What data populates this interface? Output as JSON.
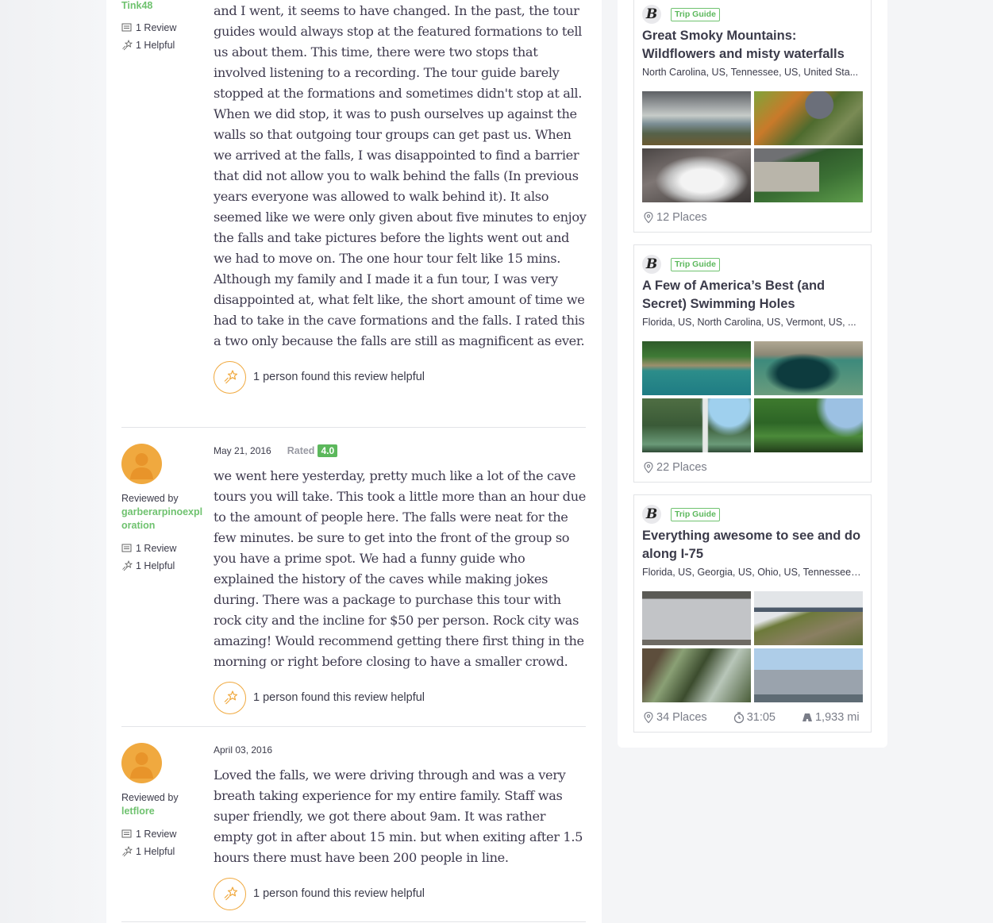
{
  "reviews": [
    {
      "reviewer_name": "Tink48",
      "review_count": "1 Review",
      "helpful_count": "1 Helpful",
      "text": "and I went, it seems to have changed. In the past, the tour guides would always stop at the featured formations to tell us about them. This time, there were two stops that involved listening to a recording. The tour guide barely stopped at the formations and sometimes didn't stop at all. When we did stop, it was to push ourselves up against the walls so that outgoing tour groups can get past us. When we arrived at the falls, I was disappointed to find a barrier that did not allow you to walk behind the falls (In previous years everyone was allowed to walk behind it). It also seemed like we were only given about five minutes to enjoy the falls and take pictures before the lights went out and we had to move on. The one hour tour felt like 15 mins. Although my family and I made it a fun tour, I was very disappointed at, what felt like, the short amount of time we had to take in the cave formations and the falls. I rated this a two only because the falls are still as magnificent as ever.",
      "helpful_text": "1 person found this review helpful"
    },
    {
      "date": "May 21, 2016",
      "rated_label": "Rated",
      "rating": "4.0",
      "reviewed_by_label": "Reviewed by",
      "reviewer_name": "garberarpinoexploration",
      "review_count": "1 Review",
      "helpful_count": "1 Helpful",
      "text": "we went here yesterday, pretty much like a lot of the cave tours you will take. This took a little more than an hour due to the amount of people here. The falls were neat for the few minutes. be sure to get into the front of the group so you have a prime spot. We had a funny guide who explained the history of the caves while making jokes during. There was a package to purchase this tour with rock city and the incline for $50 per person. Rock city was amazing! Would recommend getting there first thing in the morning or right before closing to have a smaller crowd.",
      "helpful_text": "1 person found this review helpful"
    },
    {
      "date": "April 03, 2016",
      "reviewed_by_label": "Reviewed by",
      "reviewer_name": "letflore",
      "review_count": "1 Review",
      "helpful_count": "1 Helpful",
      "text": "Loved the falls, we were driving through and was a very breath taking experience for my entire family. Staff was super friendly, we got there about 9am. It was rather empty got in after about 15 min. but when exiting after 1.5 hours there must have been 200 people in line.",
      "helpful_text": "1 person found this review helpful"
    }
  ],
  "trip_guides": [
    {
      "badge": "Trip Guide",
      "logo_letter": "B",
      "title": "Great Smoky Mountains: Wildflowers and misty waterfalls",
      "locations": "North Carolina, US, Tennessee, US, United Sta...",
      "places": "12 Places",
      "photos": [
        "mountain-vista",
        "cabin-autumn",
        "rushing-waterfall",
        "log-cabin"
      ]
    },
    {
      "badge": "Trip Guide",
      "logo_letter": "B",
      "title": "A Few of America’s Best (and Secret) Swimming Holes",
      "locations": "Florida, US, North Carolina, US, Vermont, US, ...",
      "places": "22 Places",
      "photos": [
        "spring-swimmers",
        "blue-hole",
        "grotto-waterfall",
        "green-creek"
      ]
    },
    {
      "badge": "Trip Guide",
      "logo_letter": "B",
      "title": "Everything awesome to see and do along I-75",
      "locations": "Florida, US, Georgia, US, Ohio, US, Tennessee, ...",
      "places": "34 Places",
      "duration": "31:05",
      "distance": "1,933 mi",
      "photos": [
        "pier-shop",
        "castle-rock",
        "tall-trees",
        "navy-ship-946"
      ]
    }
  ],
  "colors": {
    "accent_green": "#6fc26f",
    "rating_green": "#5cb85c",
    "helpful_orange": "#f0a93f"
  }
}
